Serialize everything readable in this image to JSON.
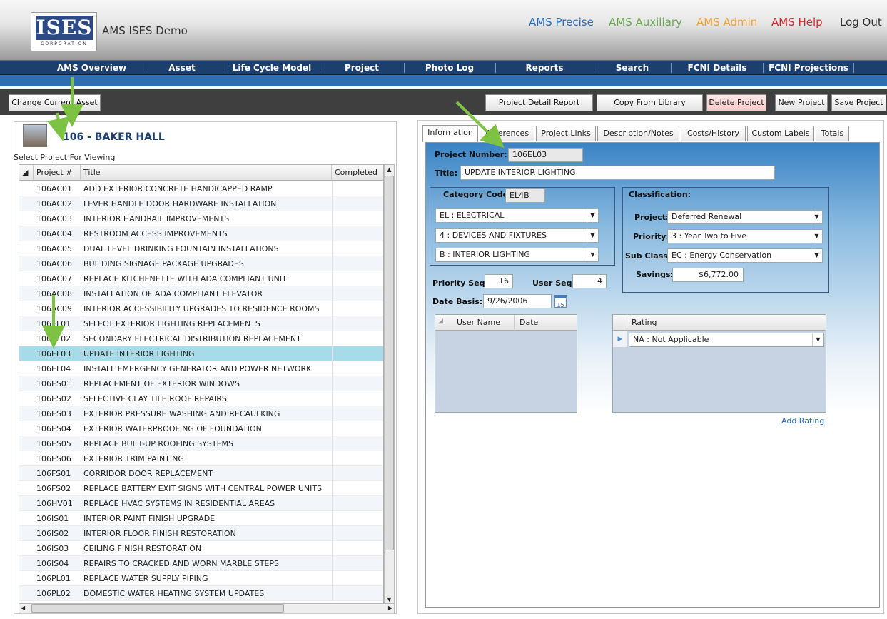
{
  "app": {
    "name": "AMS ISES Demo",
    "logo_text": "ISES",
    "logo_sub": "CORPORATION"
  },
  "top_links": [
    {
      "label": "AMS Precise",
      "color": "#2a6ebd"
    },
    {
      "label": "AMS Auxiliary",
      "color": "#6aa84f"
    },
    {
      "label": "AMS Admin",
      "color": "#f0a030"
    },
    {
      "label": "AMS Help",
      "color": "#d8262b"
    },
    {
      "label": "Log Out",
      "color": "#333333"
    }
  ],
  "nav": [
    "AMS Overview",
    "Asset",
    "Life Cycle Model",
    "Project",
    "Photo Log",
    "Reports",
    "Search",
    "FCNI Details",
    "FCNI Projections"
  ],
  "toolbar": {
    "change_asset": "Change Current Asset",
    "buttons": [
      "Project Detail Report",
      "Copy From Library",
      "Delete Project",
      "New Project",
      "Save Project"
    ]
  },
  "asset": {
    "title": "106 - BAKER HALL",
    "select_label": "Select Project For Viewing"
  },
  "grid": {
    "headers": [
      "Project #",
      "Title",
      "Completed"
    ],
    "selected": "106EL03",
    "rows": [
      [
        "106AC01",
        "ADD EXTERIOR CONCRETE HANDICAPPED RAMP"
      ],
      [
        "106AC02",
        "LEVER HANDLE DOOR HARDWARE INSTALLATION"
      ],
      [
        "106AC03",
        "INTERIOR HANDRAIL IMPROVEMENTS"
      ],
      [
        "106AC04",
        "RESTROOM ACCESS IMPROVEMENTS"
      ],
      [
        "106AC05",
        "DUAL LEVEL DRINKING FOUNTAIN INSTALLATIONS"
      ],
      [
        "106AC06",
        "BUILDING SIGNAGE PACKAGE UPGRADES"
      ],
      [
        "106AC07",
        "REPLACE KITCHENETTE WITH ADA COMPLIANT UNIT"
      ],
      [
        "106AC08",
        "INSTALLATION OF ADA COMPLIANT ELEVATOR"
      ],
      [
        "106AC09",
        "INTERIOR ACCESSIBILITY UPGRADES TO RESIDENCE ROOMS"
      ],
      [
        "106EL01",
        "SELECT EXTERIOR LIGHTING REPLACEMENTS"
      ],
      [
        "106EL02",
        "SECONDARY ELECTRICAL DISTRIBUTION REPLACEMENT"
      ],
      [
        "106EL03",
        "UPDATE INTERIOR LIGHTING"
      ],
      [
        "106EL04",
        "INSTALL EMERGENCY GENERATOR AND POWER NETWORK"
      ],
      [
        "106ES01",
        "REPLACEMENT OF EXTERIOR WINDOWS"
      ],
      [
        "106ES02",
        "SELECTIVE CLAY TILE ROOF REPAIRS"
      ],
      [
        "106ES03",
        "EXTERIOR PRESSURE WASHING AND RECAULKING"
      ],
      [
        "106ES04",
        "EXTERIOR WATERPROOFING OF FOUNDATION"
      ],
      [
        "106ES05",
        "REPLACE BUILT-UP ROOFING SYSTEMS"
      ],
      [
        "106ES06",
        "EXTERIOR TRIM PAINTING"
      ],
      [
        "106FS01",
        "CORRIDOR DOOR REPLACEMENT"
      ],
      [
        "106FS02",
        "REPLACE BATTERY EXIT SIGNS WITH CENTRAL POWER UNITS"
      ],
      [
        "106HV01",
        "REPLACE HVAC SYSTEMS IN RESIDENTIAL AREAS"
      ],
      [
        "106IS01",
        "INTERIOR PAINT FINISH UPGRADE"
      ],
      [
        "106IS02",
        "INTERIOR FLOOR FINISH RESTORATION"
      ],
      [
        "106IS03",
        "CEILING FINISH RESTORATION"
      ],
      [
        "106IS04",
        "REPAIRS TO CRACKED AND WORN MARBLE STEPS"
      ],
      [
        "106PL01",
        "REPLACE WATER SUPPLY PIPING"
      ],
      [
        "106PL02",
        "DOMESTIC WATER HEATING SYSTEM UPDATES"
      ]
    ]
  },
  "tabs": [
    "Information",
    "References",
    "Project Links",
    "Description/Notes",
    "Costs/History",
    "Custom Labels",
    "Totals"
  ],
  "info": {
    "project_number_label": "Project Number:",
    "project_number": "106EL03",
    "title_label": "Title:",
    "title": "UPDATE INTERIOR LIGHTING",
    "category_code_label": "Category Code:",
    "category_code": "EL4B",
    "category_selects": [
      "EL : ELECTRICAL",
      "4 : DEVICES AND FIXTURES",
      "B : INTERIOR LIGHTING"
    ],
    "classification_label": "Classification:",
    "project_label": "Project:",
    "project_value": "Deferred Renewal",
    "priority_label": "Priority:",
    "priority_value": "3 : Year Two to Five",
    "subclass_label": "Sub Class:",
    "subclass_value": "EC : Energy Conservation",
    "savings_label": "Savings:",
    "savings_value": "$6,772.00",
    "priority_seq_label": "Priority Seq:",
    "priority_seq": "16",
    "user_seq_label": "User Seq:",
    "user_seq": "4",
    "date_basis_label": "Date Basis:",
    "date_basis": "9/26/2006",
    "calendar_day": "15",
    "user_grid_headers": [
      "User Name",
      "Date"
    ],
    "rating_header": "Rating",
    "rating_value": "NA : Not Applicable",
    "add_rating": "Add Rating"
  }
}
